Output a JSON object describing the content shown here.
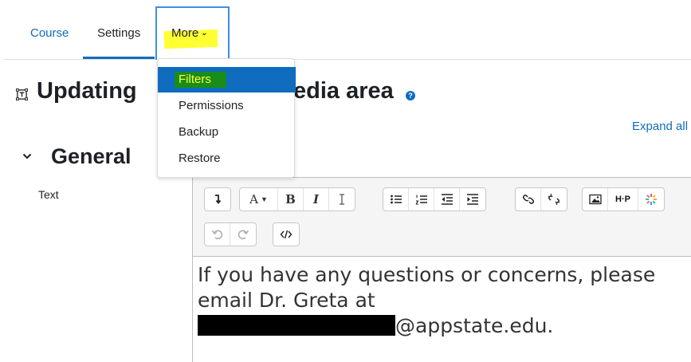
{
  "tabs": {
    "course": "Course",
    "settings": "Settings",
    "more": "More"
  },
  "heading": {
    "title_left": "Updating",
    "title_right": "edia area",
    "help_glyph": "?"
  },
  "expand_all": "Expand all",
  "section": {
    "general": "General",
    "field_label": "Text"
  },
  "dropdown": {
    "items": [
      {
        "label": "Filters",
        "active": true
      },
      {
        "label": "Permissions"
      },
      {
        "label": "Backup"
      },
      {
        "label": "Restore"
      }
    ]
  },
  "editor": {
    "line1": "If you have any questions or concerns, please",
    "line2": "email Dr. Greta at",
    "email_suffix": "@appstate.edu.",
    "toolbar_icons": [
      "collapse-icon",
      "font-style-icon",
      "bold-icon",
      "italic-icon",
      "clear-formatting-icon",
      "unordered-list-icon",
      "ordered-list-icon",
      "outdent-icon",
      "indent-icon",
      "link-icon",
      "unlink-icon",
      "image-icon",
      "h5p-icon",
      "media-icon",
      "undo-icon",
      "redo-icon",
      "html-icon"
    ],
    "labels": {
      "font": "A",
      "bold": "B",
      "italic": "I",
      "h5p": "H·P"
    }
  },
  "colors": {
    "accent": "#0f6cbf",
    "highlight_yellow": "#ffff33",
    "highlight_green": "#1a8c1a",
    "tab_outline": "#3d8ee8"
  }
}
